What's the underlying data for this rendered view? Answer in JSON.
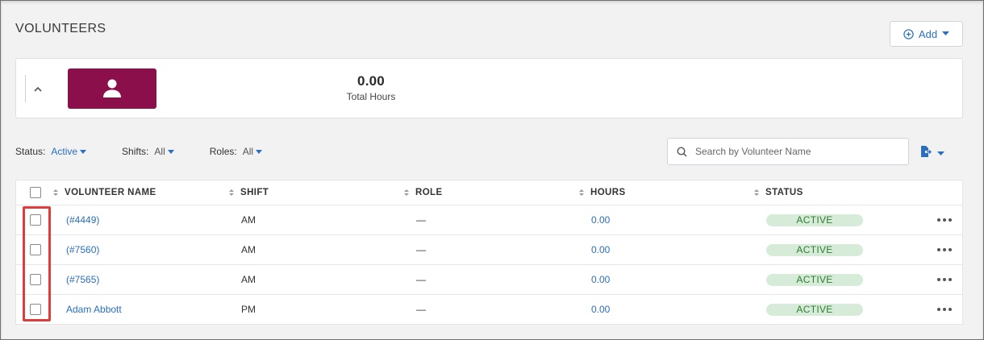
{
  "page": {
    "title": "VOLUNTEERS"
  },
  "toolbar": {
    "add_label": "Add"
  },
  "summary": {
    "value": "0.00",
    "label": "Total Hours"
  },
  "filters": [
    {
      "label": "Status:",
      "value": "Active"
    },
    {
      "label": "Shifts:",
      "value": "All"
    },
    {
      "label": "Roles:",
      "value": "All"
    }
  ],
  "search": {
    "placeholder": "Search by Volunteer Name"
  },
  "table": {
    "headers": [
      "VOLUNTEER NAME",
      "SHIFT",
      "ROLE",
      "HOURS",
      "STATUS"
    ],
    "rows": [
      {
        "name": "(#4449)",
        "shift": "AM",
        "role": "—",
        "hours": "0.00",
        "status": "ACTIVE"
      },
      {
        "name": "(#7560)",
        "shift": "AM",
        "role": "—",
        "hours": "0.00",
        "status": "ACTIVE"
      },
      {
        "name": "(#7565)",
        "shift": "AM",
        "role": "—",
        "hours": "0.00",
        "status": "ACTIVE"
      },
      {
        "name": "Adam Abbott",
        "shift": "PM",
        "role": "—",
        "hours": "0.00",
        "status": "ACTIVE"
      }
    ]
  },
  "colors": {
    "accent": "#2a6fc0",
    "tile": "#8a0f4b",
    "active_badge_bg": "#d7ecd8",
    "active_badge_text": "#2e7d32",
    "highlight": "#e03c3c"
  },
  "icons": {
    "add": "plus-circle-icon",
    "collapse": "chevron-up-icon",
    "person": "person-icon",
    "search": "search-icon",
    "export": "export-file-icon",
    "more": "more-horizontal-icon"
  }
}
